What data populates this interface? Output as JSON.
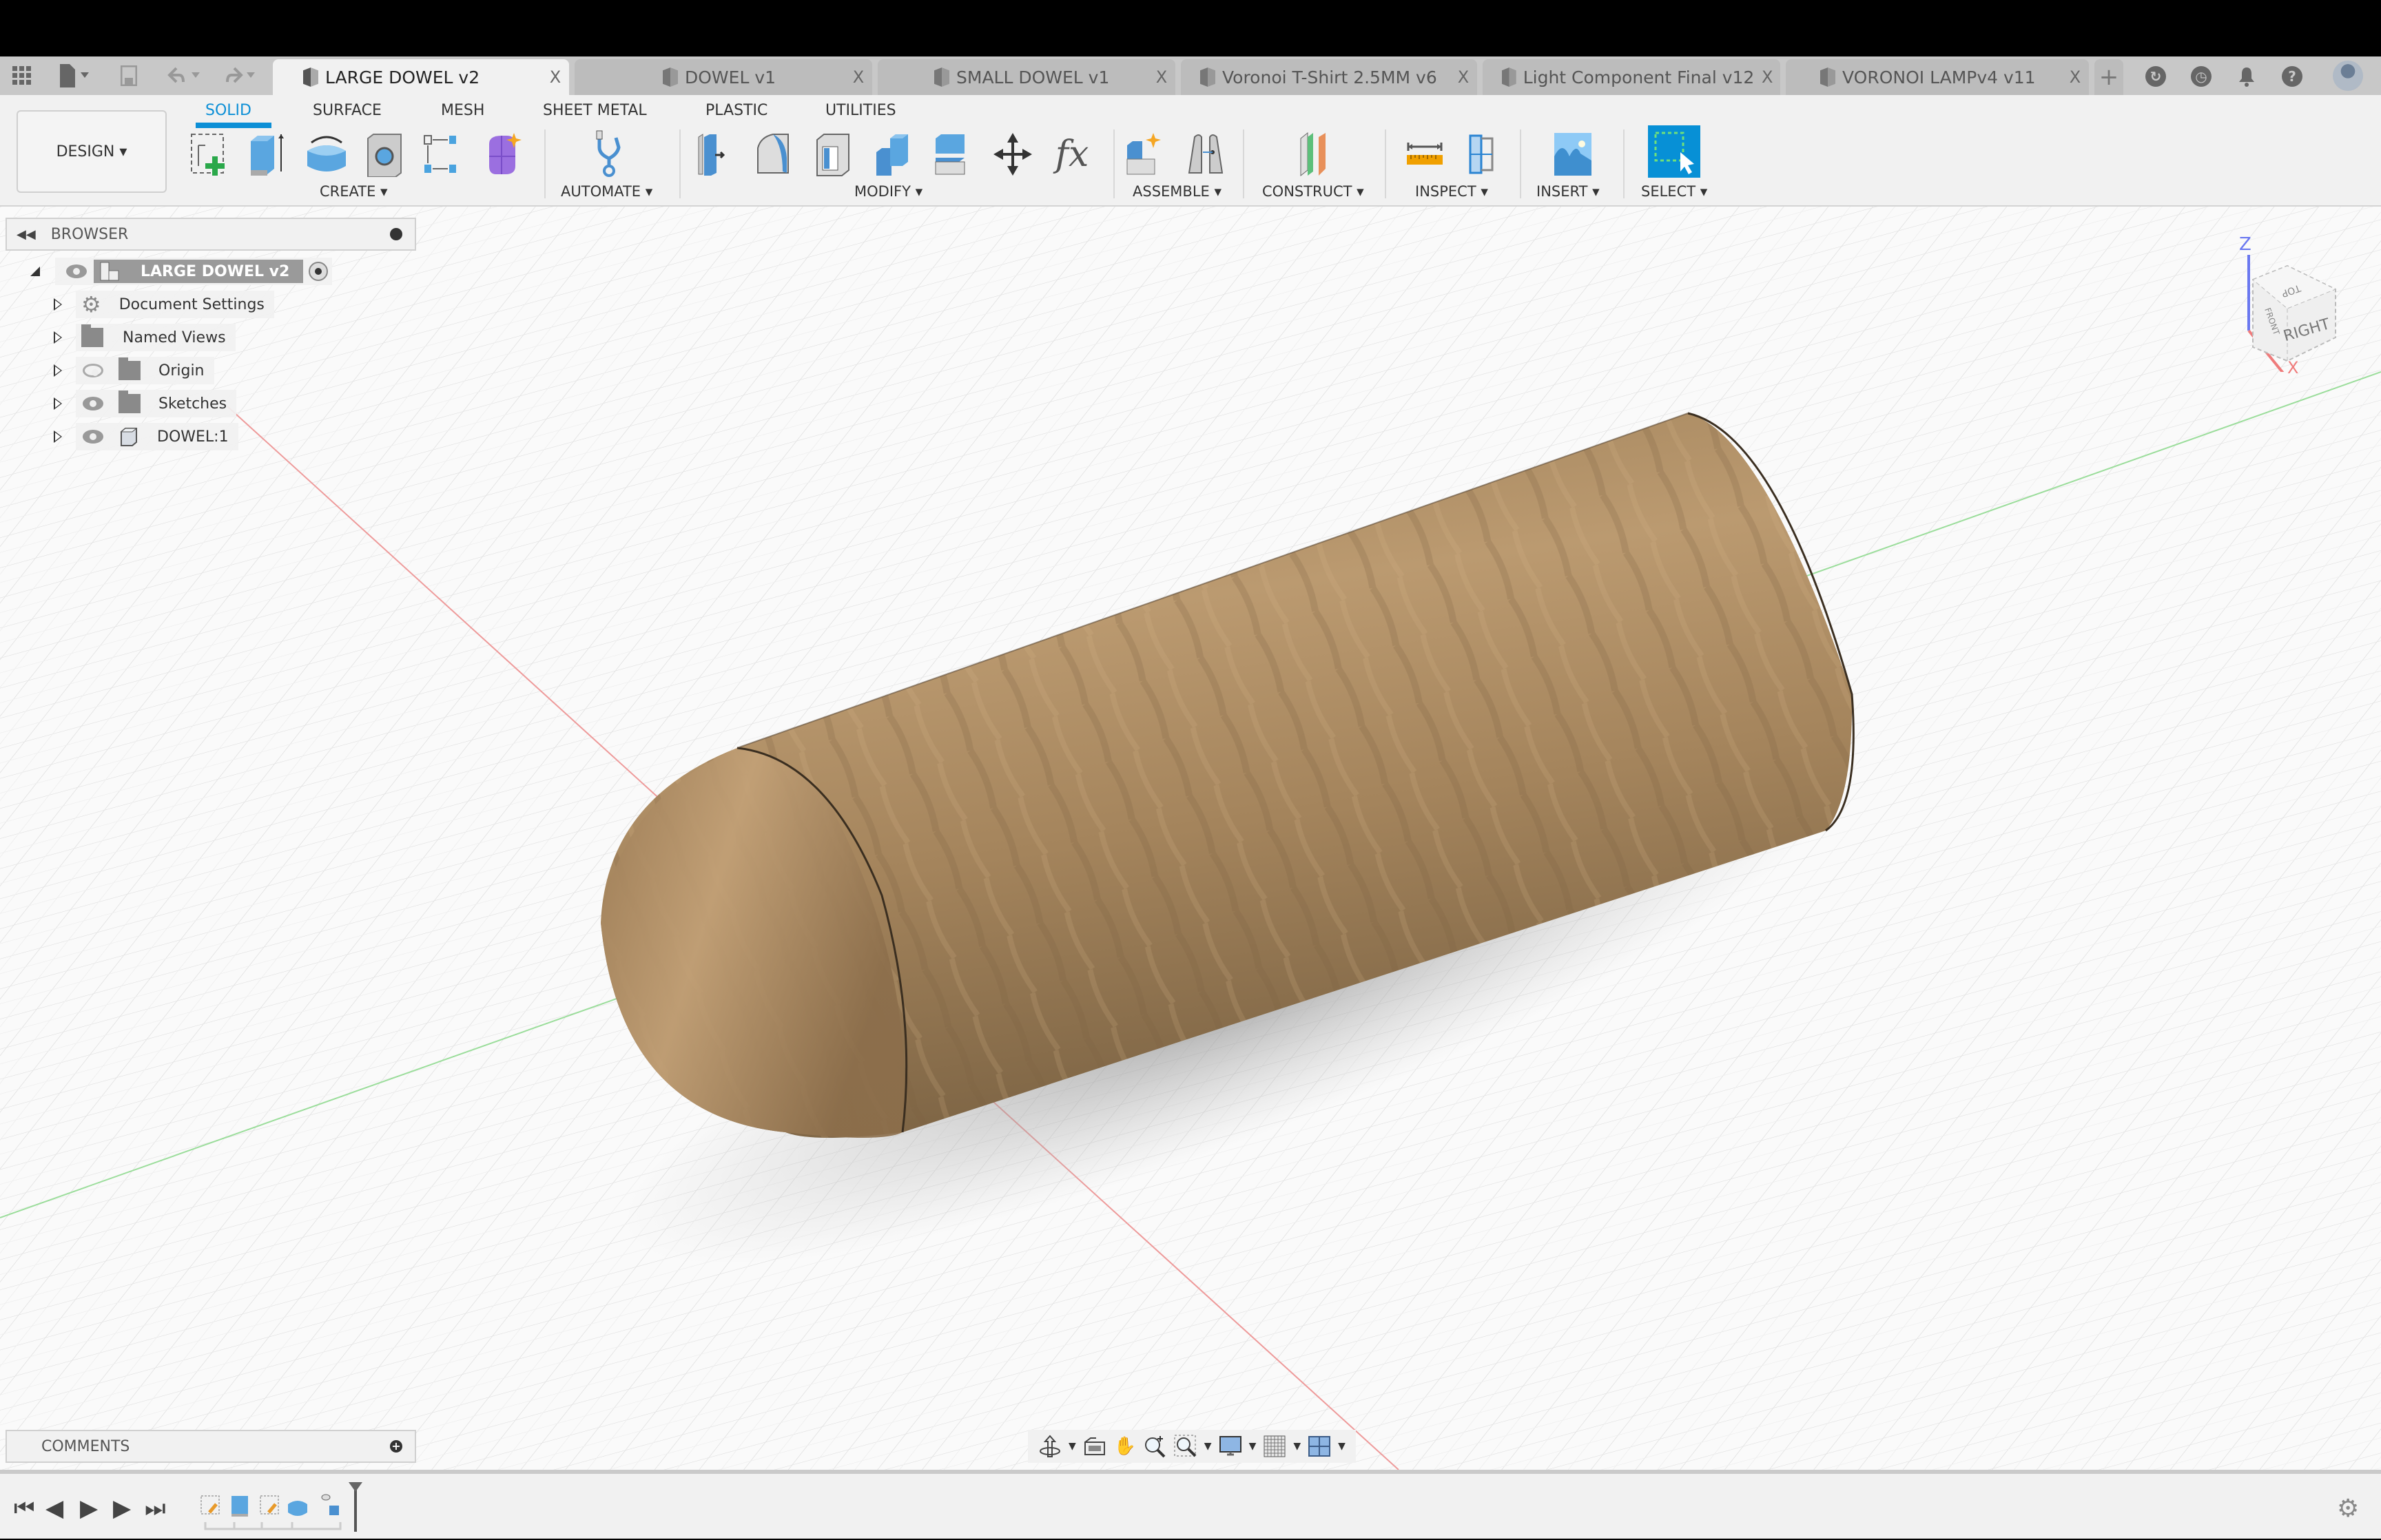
{
  "quick_access": {
    "icons": [
      "apps-grid-icon",
      "file-icon",
      "save-icon",
      "undo-icon",
      "redo-icon"
    ]
  },
  "tabs": [
    {
      "label": "LARGE DOWEL v2",
      "active": true,
      "close": "X"
    },
    {
      "label": "DOWEL v1",
      "active": false,
      "close": "X"
    },
    {
      "label": "SMALL DOWEL v1",
      "active": false,
      "close": "X"
    },
    {
      "label": "Voronoi T-Shirt 2.5MM v6",
      "active": false,
      "close": "X"
    },
    {
      "label": "Light Component Final v12",
      "active": false,
      "close": "X"
    },
    {
      "label": "VORONOI LAMPv4 v11",
      "active": false,
      "close": "X"
    }
  ],
  "tab_add": "+",
  "header_right_icons": [
    "job-status-icon",
    "history-icon",
    "notifications-icon",
    "help-icon",
    "user-avatar"
  ],
  "help_glyph": "?",
  "workspace": {
    "label": "DESIGN ▾"
  },
  "ribbon_tabs": [
    {
      "label": "SOLID",
      "active": true
    },
    {
      "label": "SURFACE",
      "active": false
    },
    {
      "label": "MESH",
      "active": false
    },
    {
      "label": "SHEET METAL",
      "active": false
    },
    {
      "label": "PLASTIC",
      "active": false
    },
    {
      "label": "UTILITIES",
      "active": false
    }
  ],
  "groups": {
    "create": "CREATE ▾",
    "automate": "AUTOMATE ▾",
    "modify": "MODIFY ▾",
    "assemble": "ASSEMBLE ▾",
    "construct": "CONSTRUCT ▾",
    "inspect": "INSPECT ▾",
    "insert": "INSERT ▾",
    "select": "SELECT ▾"
  },
  "modify_fx": "fx",
  "browser": {
    "title": "BROWSER",
    "root": "LARGE DOWEL v2",
    "items": [
      {
        "label": "Document Settings",
        "icon": "gear-icon"
      },
      {
        "label": "Named Views",
        "icon": "folder-icon"
      },
      {
        "label": "Origin",
        "icon": "folder-icon",
        "visible": false
      },
      {
        "label": "Sketches",
        "icon": "folder-icon",
        "visible": true
      },
      {
        "label": "DOWEL:1",
        "icon": "body-icon",
        "visible": true
      }
    ]
  },
  "viewcube": {
    "z_label": "Z",
    "x_label": "X",
    "top_face": "TOP",
    "right_face": "RIGHT",
    "front_face": "FRONT"
  },
  "comments": {
    "title": "COMMENTS"
  },
  "colors": {
    "accent": "#0c8fd6",
    "model": "#a8885f",
    "x_axis": "#e46c6c",
    "y_axis": "#6fd26f",
    "z_axis": "#5b6cf0"
  }
}
